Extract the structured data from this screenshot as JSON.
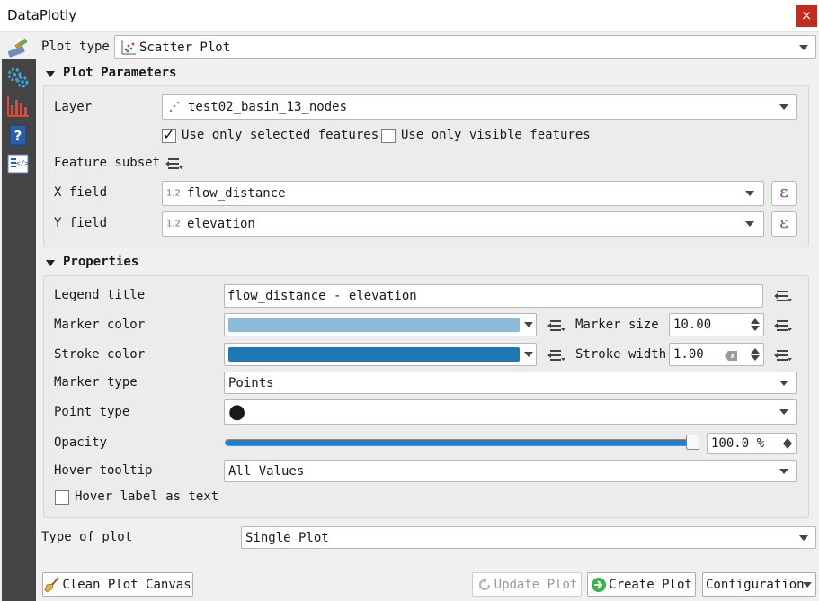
{
  "window": {
    "title": "DataPlotly",
    "close_glyph": "×"
  },
  "plot_type": {
    "label": "Plot type",
    "value": "Scatter Plot"
  },
  "plot_parameters": {
    "header": "Plot Parameters",
    "layer_label": "Layer",
    "layer_value": "test02_basin_13_nodes",
    "use_selected": {
      "label": "Use only selected features",
      "checked": true,
      "mark": "✓"
    },
    "use_visible": {
      "label": "Use only visible features",
      "checked": false
    },
    "feature_subset_label": "Feature subset",
    "x_field_label": "X field",
    "x_field_value": "flow_distance",
    "y_field_label": "Y field",
    "y_field_value": "elevation",
    "field_type_badge": "1.2",
    "expression_glyph": "ε"
  },
  "properties": {
    "header": "Properties",
    "legend_title_label": "Legend title",
    "legend_title_value": "flow_distance - elevation",
    "marker_color_label": "Marker color",
    "marker_color": "#8cbad9",
    "marker_size_label": "Marker size",
    "marker_size_value": "10.00",
    "stroke_color_label": "Stroke color",
    "stroke_color": "#1f77b4",
    "stroke_width_label": "Stroke width",
    "stroke_width_value": "1.00",
    "marker_type_label": "Marker type",
    "marker_type_value": "Points",
    "point_type_label": "Point type",
    "point_type_symbol": "●",
    "opacity_label": "Opacity",
    "opacity_value": "100.0 %",
    "opacity_fraction": 1.0,
    "hover_tooltip_label": "Hover tooltip",
    "hover_tooltip_value": "All Values",
    "hover_label_text": "Hover label as text"
  },
  "type_of_plot": {
    "label": "Type of plot",
    "value": "Single Plot"
  },
  "buttons": {
    "clean_canvas": "Clean Plot Canvas",
    "update_plot": "Update Plot",
    "create_plot": "Create Plot",
    "configuration": "Configuration"
  },
  "colors": {
    "accent": "#1e7fd0",
    "sidebar": "#444444",
    "close": "#c42b1c",
    "expression": "#8b2ea0"
  },
  "icons": [
    "plot-brush-icon",
    "settings-gears-icon",
    "bar-chart-icon",
    "help-icon",
    "code-editor-icon",
    "scatter-plot-icon",
    "point-layer-icon",
    "data-defined-override-icon",
    "expression-icon",
    "broom-icon",
    "refresh-icon",
    "create-plot-icon"
  ]
}
